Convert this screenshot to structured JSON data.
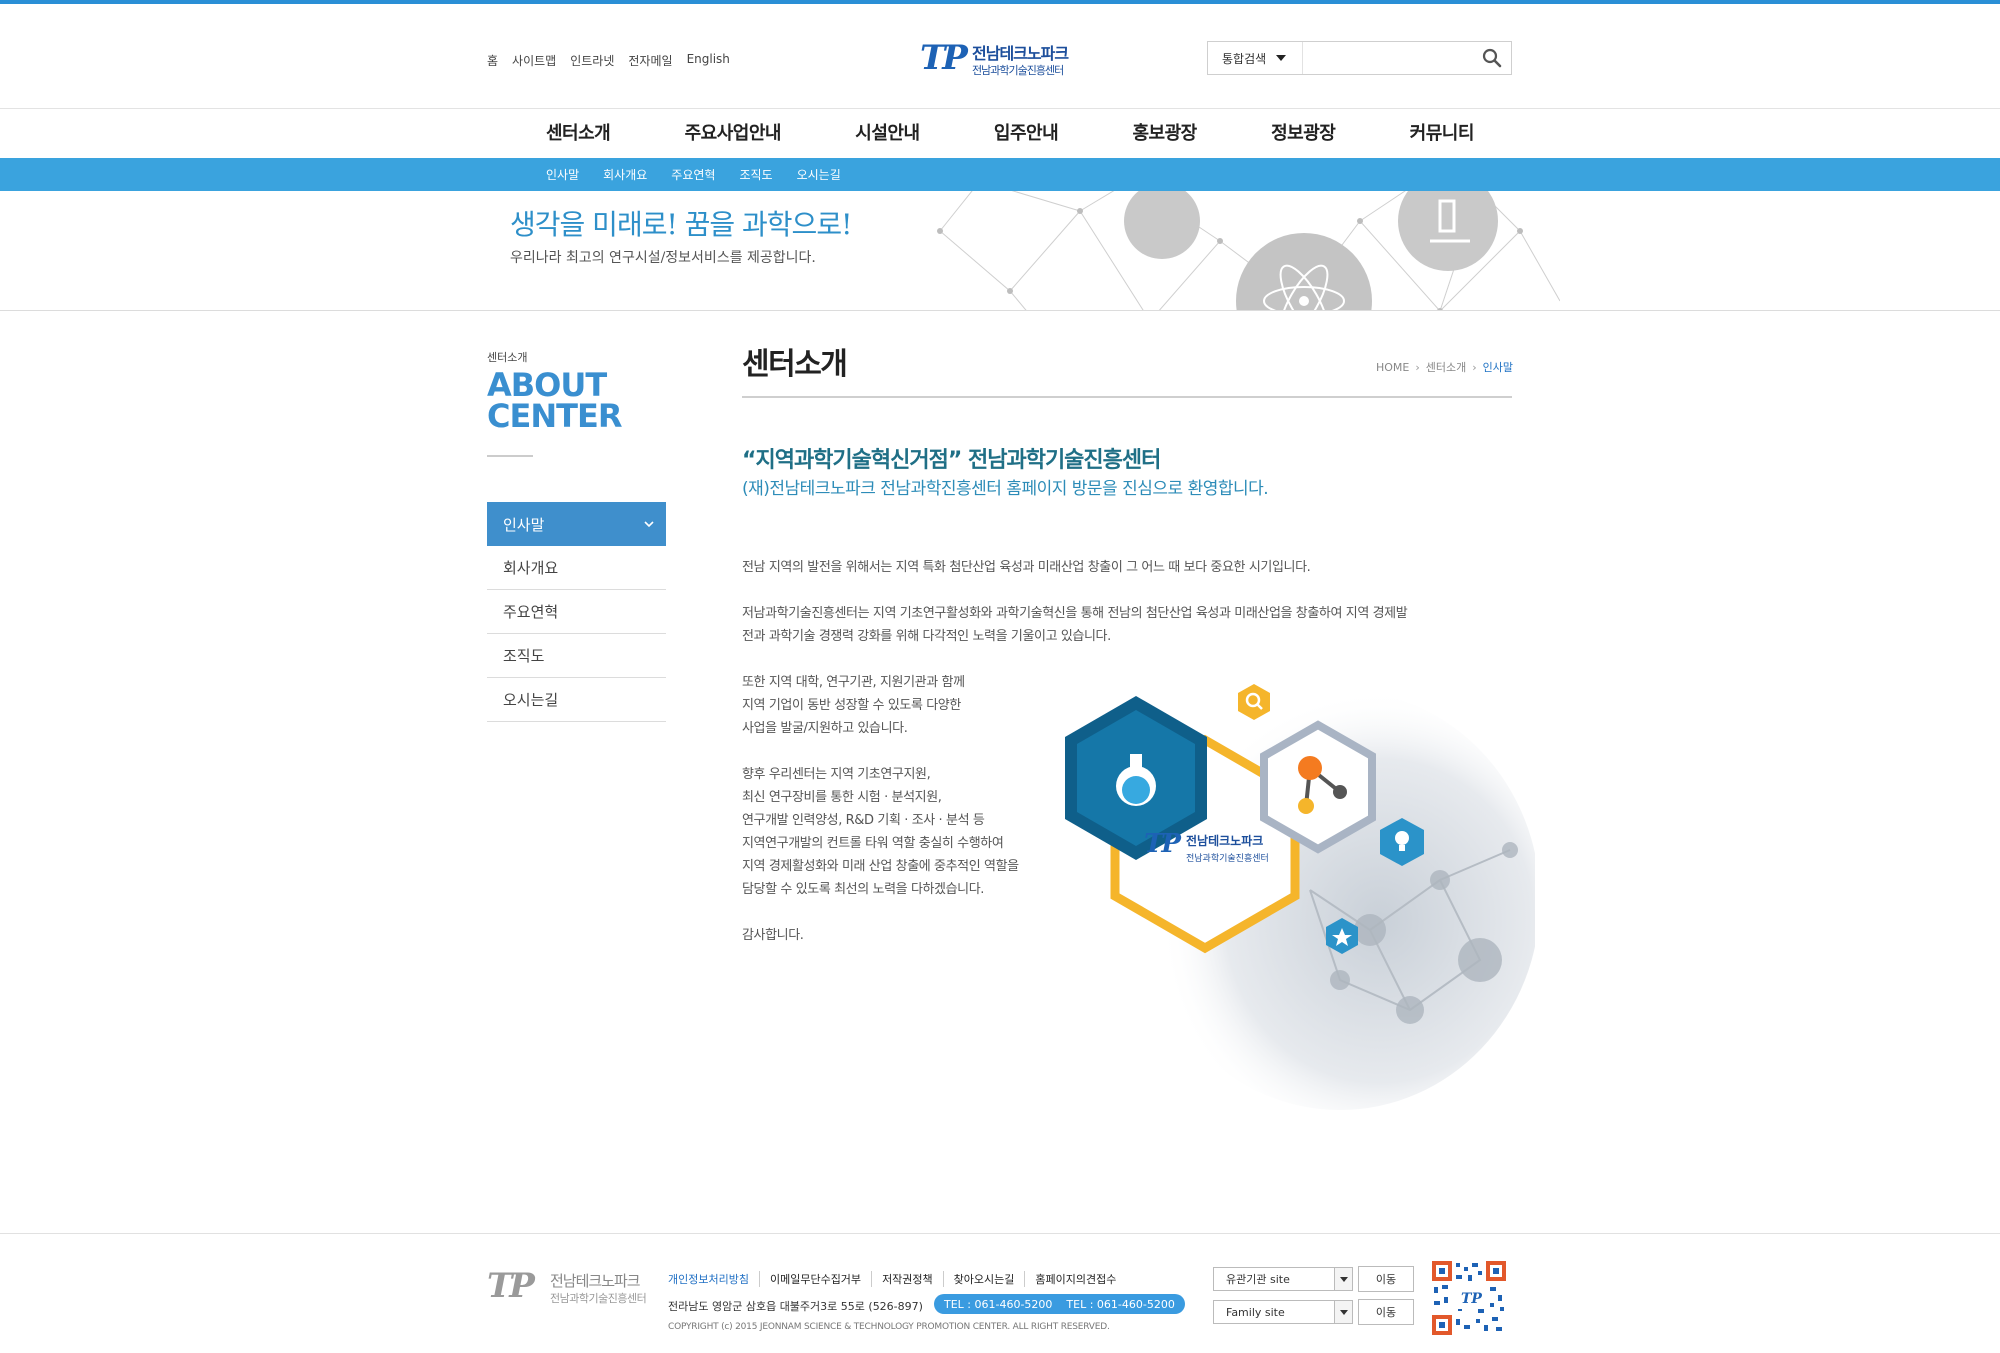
{
  "util_links": [
    "홈",
    "사이트맵",
    "인트라넷",
    "전자메일",
    "English"
  ],
  "logo": {
    "mark": "TP",
    "name": "전남테크노파크",
    "sub": "전남과학기술진흥센터"
  },
  "search": {
    "scope": "통합검색",
    "placeholder": ""
  },
  "gnb": [
    "센터소개",
    "주요사업안내",
    "시설안내",
    "입주안내",
    "홍보광장",
    "정보광장",
    "커뮤니티"
  ],
  "lnb": [
    "인사말",
    "회사개요",
    "주요연혁",
    "조직도",
    "오시는길"
  ],
  "visual": {
    "title": "생각을 미래로! 꿈을 과학으로!",
    "subtitle": "우리나라 최고의 연구시설/정보서비스를 제공합니다."
  },
  "sidebar": {
    "caption": "센터소개",
    "title_line1": "ABOUT",
    "title_line2": "CENTER",
    "items": [
      {
        "label": "인사말",
        "active": true
      },
      {
        "label": "회사개요"
      },
      {
        "label": "주요연혁"
      },
      {
        "label": "조직도"
      },
      {
        "label": "오시는길"
      }
    ]
  },
  "content": {
    "page_title": "센터소개",
    "breadcrumb": [
      "HOME",
      "센터소개",
      "인사말"
    ],
    "lead1": "“지역과학기술혁신거점” 전남과학기술진흥센터",
    "lead2": "(재)전남테크노파크 전남과학진흥센터 홈페이지 방문을 진심으로 환영합니다.",
    "p1": "전남 지역의 발전을 위해서는 지역 특화 첨단산업 육성과 미래산업 창출이 그 어느 때 보다 중요한 시기입니다.",
    "p2": [
      "저남과학기술진흥센터는 지역 기초연구활성화와 과학기술혁신을 통해 전남의 첨단산업 육성과 미래산업을 창출하여 지역 경제발",
      "전과 과학기술 경쟁력 강화를 위해 다각적인 노력을 기울이고 있습니다."
    ],
    "p3": [
      "또한 지역 대학, 연구기관, 지원기관과 함께",
      "지역 기업이 동반 성장할 수 있도록 다양한",
      "사업을 발굴/지원하고 있습니다."
    ],
    "p4": [
      "향후 우리센터는 지역 기초연구지원,",
      "최신 연구장비를 통한 시험 · 분석지원,",
      "연구개발 인력양성, R&D 기획 · 조사  · 분석 등",
      "지역연구개발의 컨트롤 타워 역할 충실히 수행하여",
      "지역 경제활성화와 미래 산업 창출에 중추적인 역할을",
      "담당할 수 있도록 최선의 노력을 다하겠습니다."
    ],
    "p5": "감사합니다.",
    "illus_logo_name": "전남테크노파크",
    "illus_logo_sub": "전남과학기술진흥센터"
  },
  "footer": {
    "logo_name": "전남테크노파크",
    "logo_sub": "전남과학기술진흥센터",
    "links": [
      "개인정보처리방침",
      "이메일무단수집거부",
      "저작권정책",
      "찾아오시는길",
      "홈페이지의견접수"
    ],
    "address": "전라남도 영암군 삼호읍 대불주거3로 55로 (526-897)",
    "tel1": "TEL : 061-460-5200",
    "tel2": "TEL : 061-460-5200",
    "copyright": "COPYRIGHT (c) 2015 JEONNAM SCIENCE & TECHNOLOGY PROMOTION CENTER. ALL RIGHT RESERVED.",
    "select1": "유관기관 site",
    "select2": "Family site",
    "go_label": "이동"
  },
  "colors": {
    "accent": "#3aa3de",
    "brand": "#1d62b5",
    "sidebar_active": "#3f8fcc",
    "hex_navy": "#0f5f8a",
    "hex_yellow": "#f5b52b"
  }
}
